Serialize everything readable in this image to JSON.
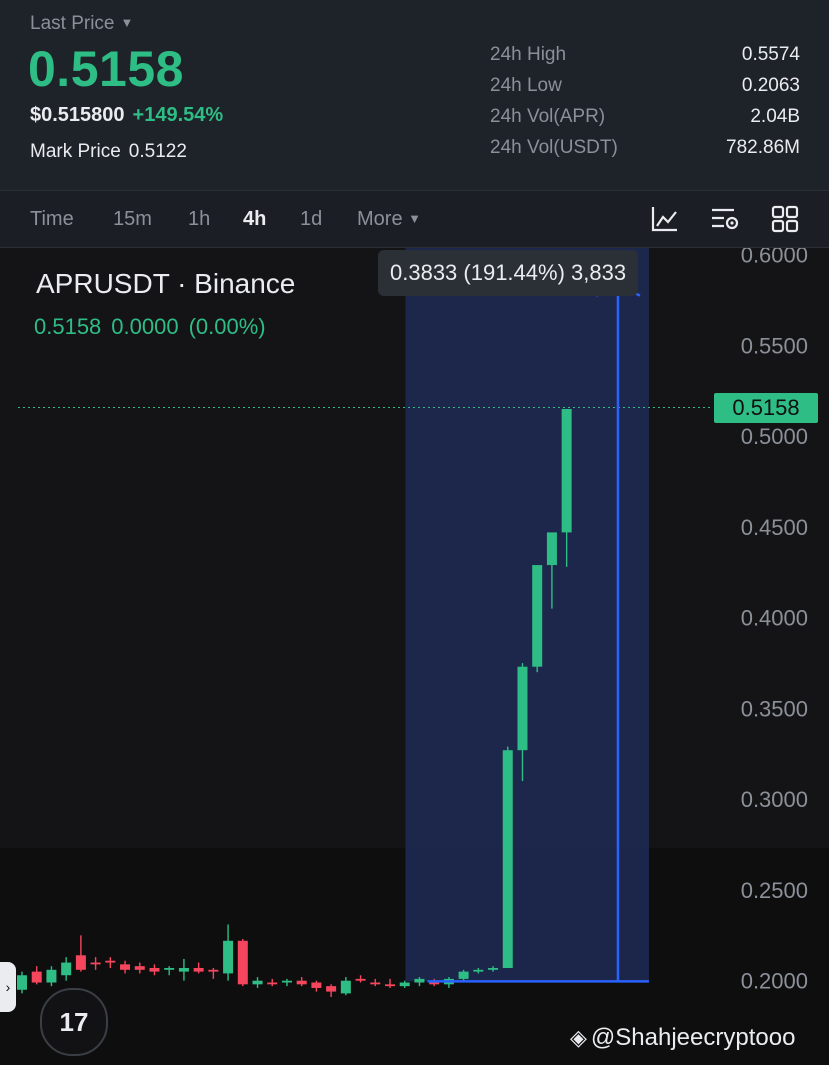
{
  "header": {
    "last_price_label": "Last Price",
    "last_price": "0.5158",
    "usd_price": "$0.515800",
    "change_pct": "+149.54%",
    "mark_price_label": "Mark Price",
    "mark_price": "0.5122",
    "stats": [
      {
        "label": "24h High",
        "value": "0.5574"
      },
      {
        "label": "24h Low",
        "value": "0.2063"
      },
      {
        "label": "24h Vol(APR)",
        "value": "2.04B"
      },
      {
        "label": "24h Vol(USDT)",
        "value": "782.86M"
      }
    ]
  },
  "toolbar": {
    "tabs": [
      "Time",
      "15m",
      "1h",
      "4h",
      "1d",
      "More"
    ],
    "active_tab": "4h"
  },
  "chart_info": {
    "symbol": "APRUSDT · Binance",
    "last": "0.5158",
    "change": "0.0000",
    "change_pct": "(0.00%)",
    "measure_tooltip": "0.3833 (191.44%) 3,833",
    "current_price_tag": "0.5158"
  },
  "colors": {
    "up": "#2ebd85",
    "down": "#f6465d",
    "measure": "#2962ff",
    "background": "#121214"
  },
  "chart_data": {
    "type": "candlestick",
    "price_axis": [
      "0.6000",
      "0.5500",
      "0.5000",
      "0.4500",
      "0.4000",
      "0.3500",
      "0.3000",
      "0.2500",
      "0.2000"
    ],
    "ylim": [
      0.2,
      0.6
    ],
    "current_price": 0.5158,
    "measure": {
      "from": 0.1996,
      "to": 0.583,
      "change": "0.3833",
      "pct": "191.44%",
      "bars": "3,833",
      "start_candle": 27,
      "end_candle": 43
    },
    "candles": [
      {
        "o": 0.195,
        "h": 0.205,
        "l": 0.193,
        "c": 0.203
      },
      {
        "o": 0.205,
        "h": 0.208,
        "l": 0.198,
        "c": 0.199
      },
      {
        "o": 0.199,
        "h": 0.208,
        "l": 0.197,
        "c": 0.206
      },
      {
        "o": 0.203,
        "h": 0.213,
        "l": 0.2,
        "c": 0.21
      },
      {
        "o": 0.214,
        "h": 0.225,
        "l": 0.205,
        "c": 0.206
      },
      {
        "o": 0.21,
        "h": 0.213,
        "l": 0.206,
        "c": 0.209
      },
      {
        "o": 0.211,
        "h": 0.213,
        "l": 0.207,
        "c": 0.21
      },
      {
        "o": 0.209,
        "h": 0.211,
        "l": 0.204,
        "c": 0.206
      },
      {
        "o": 0.208,
        "h": 0.21,
        "l": 0.204,
        "c": 0.206
      },
      {
        "o": 0.207,
        "h": 0.209,
        "l": 0.203,
        "c": 0.205
      },
      {
        "o": 0.206,
        "h": 0.208,
        "l": 0.203,
        "c": 0.207
      },
      {
        "o": 0.205,
        "h": 0.212,
        "l": 0.2,
        "c": 0.207
      },
      {
        "o": 0.207,
        "h": 0.21,
        "l": 0.204,
        "c": 0.205
      },
      {
        "o": 0.206,
        "h": 0.207,
        "l": 0.201,
        "c": 0.205
      },
      {
        "o": 0.204,
        "h": 0.231,
        "l": 0.2,
        "c": 0.222
      },
      {
        "o": 0.222,
        "h": 0.223,
        "l": 0.197,
        "c": 0.198
      },
      {
        "o": 0.198,
        "h": 0.202,
        "l": 0.196,
        "c": 0.2
      },
      {
        "o": 0.199,
        "h": 0.201,
        "l": 0.197,
        "c": 0.198
      },
      {
        "o": 0.199,
        "h": 0.201,
        "l": 0.197,
        "c": 0.2
      },
      {
        "o": 0.2,
        "h": 0.202,
        "l": 0.197,
        "c": 0.198
      },
      {
        "o": 0.199,
        "h": 0.2,
        "l": 0.194,
        "c": 0.196
      },
      {
        "o": 0.197,
        "h": 0.198,
        "l": 0.191,
        "c": 0.194
      },
      {
        "o": 0.193,
        "h": 0.202,
        "l": 0.192,
        "c": 0.2
      },
      {
        "o": 0.201,
        "h": 0.203,
        "l": 0.199,
        "c": 0.2
      },
      {
        "o": 0.199,
        "h": 0.201,
        "l": 0.197,
        "c": 0.198
      },
      {
        "o": 0.198,
        "h": 0.201,
        "l": 0.196,
        "c": 0.197
      },
      {
        "o": 0.197,
        "h": 0.2,
        "l": 0.196,
        "c": 0.199
      },
      {
        "o": 0.199,
        "h": 0.202,
        "l": 0.197,
        "c": 0.201
      },
      {
        "o": 0.199,
        "h": 0.201,
        "l": 0.197,
        "c": 0.198
      },
      {
        "o": 0.198,
        "h": 0.202,
        "l": 0.196,
        "c": 0.201
      },
      {
        "o": 0.201,
        "h": 0.206,
        "l": 0.2,
        "c": 0.205
      },
      {
        "o": 0.205,
        "h": 0.207,
        "l": 0.204,
        "c": 0.206
      },
      {
        "o": 0.206,
        "h": 0.208,
        "l": 0.205,
        "c": 0.207
      },
      {
        "o": 0.207,
        "h": 0.329,
        "l": 0.207,
        "c": 0.327
      },
      {
        "o": 0.327,
        "h": 0.375,
        "l": 0.31,
        "c": 0.373
      },
      {
        "o": 0.373,
        "h": 0.42,
        "l": 0.37,
        "c": 0.429
      },
      {
        "o": 0.429,
        "h": 0.444,
        "l": 0.405,
        "c": 0.447
      },
      {
        "o": 0.447,
        "h": 0.456,
        "l": 0.428,
        "c": 0.515
      }
    ]
  },
  "watermark": "@Shahjeecryptooo",
  "tv_logo": "17"
}
